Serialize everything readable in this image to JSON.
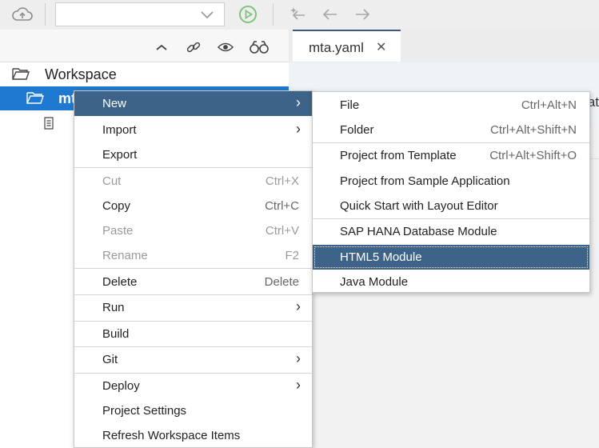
{
  "toolbar": {
    "combo_value": "",
    "icons": [
      "cloud-upload-icon",
      "play-icon",
      "sparkle-arrow-icon",
      "back-arrow-icon",
      "forward-arrow-icon"
    ]
  },
  "left_panel": {
    "header_icons": [
      "collapse-icon",
      "link-icon",
      "eye-icon",
      "binoculars-icon"
    ]
  },
  "tree": {
    "workspace_label": "Workspace",
    "project_label": "mt"
  },
  "editor": {
    "tab_label": "mta.yaml",
    "tab_close": "✕",
    "partial_text": "at"
  },
  "context_menu": {
    "items": [
      {
        "label": "New",
        "shortcut": "",
        "submenu": true
      },
      {
        "label": "Import",
        "shortcut": "",
        "submenu": true
      },
      {
        "label": "Export",
        "shortcut": ""
      },
      {
        "label": "Cut",
        "shortcut": "Ctrl+X"
      },
      {
        "label": "Copy",
        "shortcut": "Ctrl+C"
      },
      {
        "label": "Paste",
        "shortcut": "Ctrl+V"
      },
      {
        "label": "Rename",
        "shortcut": "F2"
      },
      {
        "label": "Delete",
        "shortcut": "Delete"
      },
      {
        "label": "Run",
        "shortcut": "",
        "submenu": true
      },
      {
        "label": "Build",
        "shortcut": ""
      },
      {
        "label": "Git",
        "shortcut": "",
        "submenu": true
      },
      {
        "label": "Deploy",
        "shortcut": "",
        "submenu": true
      },
      {
        "label": "Project Settings",
        "shortcut": ""
      },
      {
        "label": "Refresh Workspace Items",
        "shortcut": ""
      }
    ],
    "chevron": "›"
  },
  "new_submenu": {
    "items": [
      {
        "label": "File",
        "shortcut": "Ctrl+Alt+N"
      },
      {
        "label": "Folder",
        "shortcut": "Ctrl+Alt+Shift+N"
      },
      {
        "label": "Project from Template",
        "shortcut": "Ctrl+Alt+Shift+O"
      },
      {
        "label": "Project from Sample Application",
        "shortcut": ""
      },
      {
        "label": "Quick Start with Layout Editor",
        "shortcut": ""
      },
      {
        "label": "SAP HANA Database Module",
        "shortcut": ""
      },
      {
        "label": "HTML5 Module",
        "shortcut": ""
      },
      {
        "label": "Java Module",
        "shortcut": ""
      }
    ]
  },
  "colors": {
    "selection_blue": "#1d7ad0",
    "menu_highlight": "#3d6388",
    "toolbar_bg": "#eeeeee"
  }
}
